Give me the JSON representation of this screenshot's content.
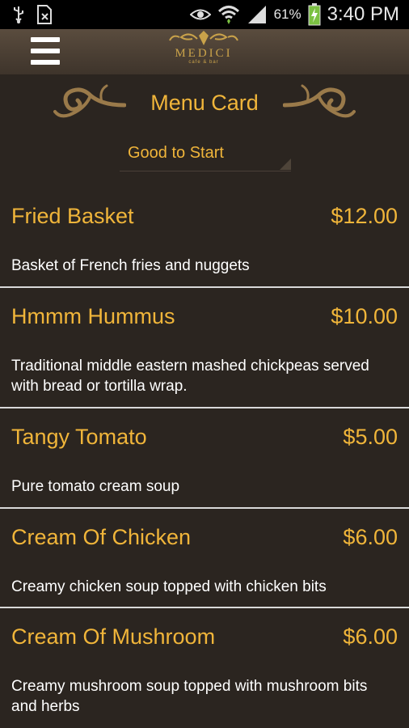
{
  "status_bar": {
    "battery_percent": "61%",
    "time": "3:40 PM"
  },
  "header": {
    "logo_text": "MEDICI",
    "logo_subtext": "cafe & bar"
  },
  "page": {
    "title": "Menu Card",
    "category": "Good to Start"
  },
  "items": [
    {
      "name": "Fried Basket",
      "price": "$12.00",
      "description": "Basket of French fries and nuggets"
    },
    {
      "name": "Hmmm Hummus",
      "price": "$10.00",
      "description": "Traditional middle eastern mashed chickpeas served with bread or tortilla wrap."
    },
    {
      "name": "Tangy Tomato",
      "price": "$5.00",
      "description": "Pure tomato cream soup"
    },
    {
      "name": "Cream Of Chicken",
      "price": "$6.00",
      "description": "Creamy chicken soup topped with chicken bits"
    },
    {
      "name": "Cream Of Mushroom",
      "price": "$6.00",
      "description": "Creamy mushroom soup topped with mushroom bits and herbs"
    }
  ],
  "colors": {
    "background": "#2b2520",
    "accent": "#f0b53a",
    "header": "#4a3f34"
  }
}
